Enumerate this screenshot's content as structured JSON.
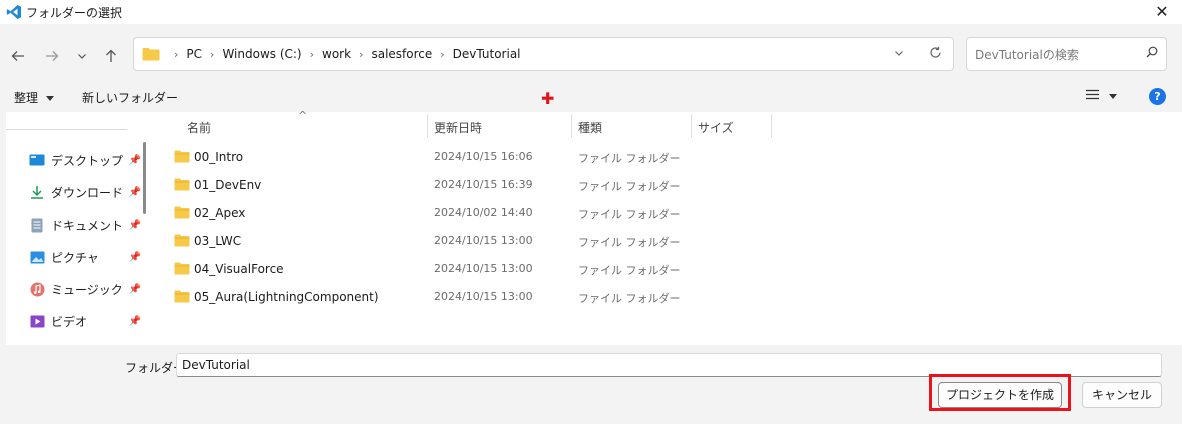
{
  "window": {
    "title": "フォルダーの選択",
    "close_glyph": "✕"
  },
  "nav": {
    "back_icon": "arrow-left-icon",
    "forward_icon": "arrow-right-icon",
    "recent_icon": "chevron-down-icon",
    "up_icon": "arrow-up-icon",
    "breadcrumbs": [
      "PC",
      "Windows (C:)",
      "work",
      "salesforce",
      "DevTutorial"
    ],
    "search_placeholder": "DevTutorialの検索"
  },
  "commands": {
    "organize": "整理",
    "new_folder": "新しいフォルダー",
    "help": "?"
  },
  "sidebar": {
    "items": [
      {
        "label": "デスクトップ",
        "icon": "desktop-icon"
      },
      {
        "label": "ダウンロード",
        "icon": "download-icon"
      },
      {
        "label": "ドキュメント",
        "icon": "document-icon"
      },
      {
        "label": "ピクチャ",
        "icon": "picture-icon"
      },
      {
        "label": "ミュージック",
        "icon": "music-icon"
      },
      {
        "label": "ビデオ",
        "icon": "video-icon"
      }
    ]
  },
  "table": {
    "columns": [
      "名前",
      "更新日時",
      "種類",
      "サイズ"
    ],
    "rows": [
      {
        "name": "00_Intro",
        "date": "2024/10/15 16:06",
        "type": "ファイル フォルダー"
      },
      {
        "name": "01_DevEnv",
        "date": "2024/10/15 16:39",
        "type": "ファイル フォルダー"
      },
      {
        "name": "02_Apex",
        "date": "2024/10/02 14:40",
        "type": "ファイル フォルダー"
      },
      {
        "name": "03_LWC",
        "date": "2024/10/15 13:00",
        "type": "ファイル フォルダー"
      },
      {
        "name": "04_VisualForce",
        "date": "2024/10/15 13:00",
        "type": "ファイル フォルダー"
      },
      {
        "name": "05_Aura(LightningComponent)",
        "date": "2024/10/15 13:00",
        "type": "ファイル フォルダー"
      }
    ]
  },
  "footer": {
    "folder_label": "フォルダー:",
    "folder_value": "DevTutorial",
    "create_button": "プロジェクトを作成",
    "cancel_button": "キャンセル"
  },
  "colors": {
    "accent": "#1a73e8",
    "highlight": "#e8131b",
    "folder": "#f7c948"
  }
}
